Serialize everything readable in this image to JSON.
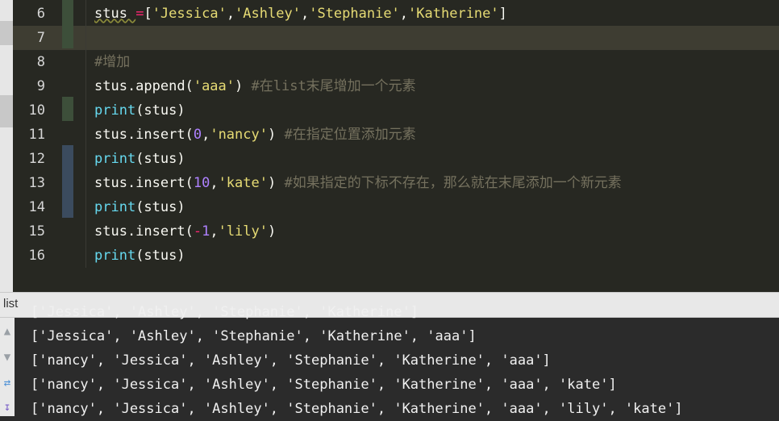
{
  "editor": {
    "lines": [
      {
        "no": "6",
        "parts": [
          [
            "",
            "stus "
          ],
          [
            "op",
            "="
          ],
          [
            "",
            "["
          ],
          [
            "str",
            "'Jessica'"
          ],
          [
            "",
            ","
          ],
          [
            "str",
            "'Ashley'"
          ],
          [
            "",
            ","
          ],
          [
            "str",
            "'Stephanie'"
          ],
          [
            "",
            ","
          ],
          [
            "str",
            "'Katherine'"
          ],
          [
            "",
            "]"
          ]
        ]
      },
      {
        "no": "7",
        "parts": []
      },
      {
        "no": "8",
        "parts": [
          [
            "cm",
            "#增加"
          ]
        ]
      },
      {
        "no": "9",
        "parts": [
          [
            "",
            "stus.append("
          ],
          [
            "str",
            "'aaa'"
          ],
          [
            "",
            ") "
          ],
          [
            "cm",
            "#在list末尾增加一个元素"
          ]
        ]
      },
      {
        "no": "10",
        "parts": [
          [
            "kw",
            "print"
          ],
          [
            "",
            "(stus)"
          ]
        ]
      },
      {
        "no": "11",
        "parts": [
          [
            "",
            "stus.insert("
          ],
          [
            "num",
            "0"
          ],
          [
            "",
            ","
          ],
          [
            "str",
            "'nancy'"
          ],
          [
            "",
            ") "
          ],
          [
            "cm",
            "#在指定位置添加元素"
          ]
        ]
      },
      {
        "no": "12",
        "parts": [
          [
            "kw",
            "print"
          ],
          [
            "",
            "(stus)"
          ]
        ]
      },
      {
        "no": "13",
        "parts": [
          [
            "",
            "stus.insert("
          ],
          [
            "num",
            "10"
          ],
          [
            "",
            ","
          ],
          [
            "str",
            "'kate'"
          ],
          [
            "",
            ") "
          ],
          [
            "cm",
            "#如果指定的下标不存在，那么就在末尾添加一个新元素"
          ]
        ]
      },
      {
        "no": "14",
        "parts": [
          [
            "kw",
            "print"
          ],
          [
            "",
            "(stus)"
          ]
        ]
      },
      {
        "no": "15",
        "parts": [
          [
            "",
            "stus.insert("
          ],
          [
            "op",
            "-"
          ],
          [
            "num",
            "1"
          ],
          [
            "",
            ","
          ],
          [
            "str",
            "'lily'"
          ],
          [
            "",
            ")"
          ]
        ]
      },
      {
        "no": "16",
        "parts": [
          [
            "kw",
            "print"
          ],
          [
            "",
            "(stus)"
          ]
        ]
      }
    ]
  },
  "run_panel": {
    "title": "list",
    "partial_line": "['Jessica', 'Ashley', 'Stephanie', 'Katherine']",
    "output": [
      "['Jessica', 'Ashley', 'Stephanie', 'Katherine', 'aaa']",
      "['nancy', 'Jessica', 'Ashley', 'Stephanie', 'Katherine', 'aaa']",
      "['nancy', 'Jessica', 'Ashley', 'Stephanie', 'Katherine', 'aaa', 'kate']",
      "['nancy', 'Jessica', 'Ashley', 'Stephanie', 'Katherine', 'aaa', 'lily', 'kate']"
    ],
    "tools": [
      "arrow-up-icon",
      "arrow-down-icon",
      "soft-wrap-icon",
      "scroll-to-end-icon"
    ]
  }
}
